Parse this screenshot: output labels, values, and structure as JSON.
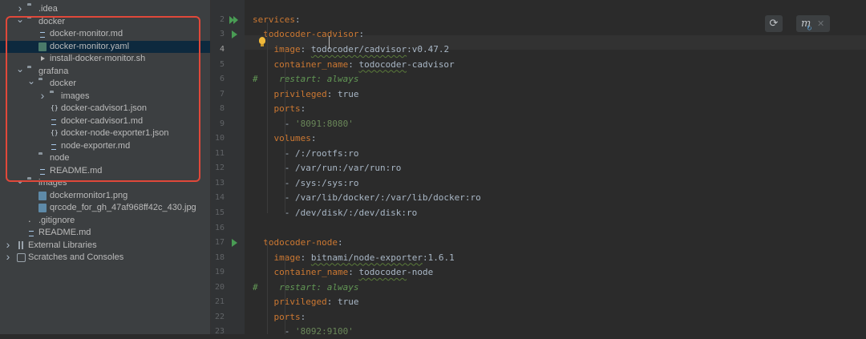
{
  "project_tree": [
    {
      "label": ".idea",
      "depth": 0,
      "kind": "folder",
      "arrow": "right",
      "icon": "folder-icon"
    },
    {
      "label": "docker",
      "depth": 0,
      "kind": "folder",
      "arrow": "down",
      "icon": "folder-icon"
    },
    {
      "label": "docker-monitor.md",
      "depth": 1,
      "kind": "file",
      "icon": "markdown-file-icon"
    },
    {
      "label": "docker-monitor.yaml",
      "depth": 1,
      "kind": "file",
      "icon": "yaml-file-icon",
      "selected": true
    },
    {
      "label": "install-docker-monitor.sh",
      "depth": 1,
      "kind": "file",
      "icon": "shell-script-icon"
    },
    {
      "label": "grafana",
      "depth": 0,
      "kind": "folder",
      "arrow": "down",
      "icon": "folder-icon"
    },
    {
      "label": "docker",
      "depth": 1,
      "kind": "folder",
      "arrow": "down",
      "icon": "folder-icon"
    },
    {
      "label": "images",
      "depth": 2,
      "kind": "folder",
      "arrow": "right",
      "icon": "folder-icon"
    },
    {
      "label": "docker-cadvisor1.json",
      "depth": 2,
      "kind": "file",
      "icon": "json-file-icon"
    },
    {
      "label": "docker-cadvisor1.md",
      "depth": 2,
      "kind": "file",
      "icon": "markdown-file-icon"
    },
    {
      "label": "docker-node-exporter1.json",
      "depth": 2,
      "kind": "file",
      "icon": "json-file-icon"
    },
    {
      "label": "node-exporter.md",
      "depth": 2,
      "kind": "file",
      "icon": "markdown-file-icon"
    },
    {
      "label": "node",
      "depth": 1,
      "kind": "folder",
      "icon": "folder-icon"
    },
    {
      "label": "README.md",
      "depth": 1,
      "kind": "file",
      "icon": "markdown-file-icon"
    },
    {
      "label": "images",
      "depth": 0,
      "kind": "folder",
      "arrow": "down",
      "icon": "folder-icon"
    },
    {
      "label": "dockermonitor1.png",
      "depth": 1,
      "kind": "file",
      "icon": "image-file-icon"
    },
    {
      "label": "qrcode_for_gh_47af968ff42c_430.jpg",
      "depth": 1,
      "kind": "file",
      "icon": "image-file-icon"
    },
    {
      "label": ".gitignore",
      "depth": 0,
      "kind": "file",
      "icon": "gitignore-file-icon"
    },
    {
      "label": "README.md",
      "depth": 0,
      "kind": "file",
      "icon": "markdown-file-icon"
    },
    {
      "label": "External Libraries",
      "depth": -1,
      "kind": "special",
      "arrow": "right",
      "icon": "libraries-icon"
    },
    {
      "label": "Scratches and Consoles",
      "depth": -1,
      "kind": "special",
      "arrow": "right",
      "icon": "scratches-icon"
    }
  ],
  "editor": {
    "current_line": 4,
    "top_partial": [
      {
        "t": "version: ",
        "c": "k"
      }
    ],
    "lines": [
      {
        "n": 2,
        "gutter": "double-run",
        "tokens": [
          {
            "t": "services",
            "c": "k"
          },
          {
            "t": ":",
            "c": "w"
          }
        ]
      },
      {
        "n": 3,
        "gutter": "run",
        "tokens": [
          {
            "t": "  "
          },
          {
            "t": "todocoder-cadvisor",
            "c": "k"
          },
          {
            "t": ":",
            "c": "w"
          }
        ]
      },
      {
        "n": 4,
        "tokens": [
          {
            "t": "    "
          },
          {
            "t": "image",
            "c": "k"
          },
          {
            "t": ": ",
            "c": "w"
          },
          {
            "t": "todocoder/cadvisor",
            "c": "v"
          },
          {
            "t": ":v0.47.2",
            "c": "w"
          }
        ]
      },
      {
        "n": 5,
        "tokens": [
          {
            "t": "    "
          },
          {
            "t": "container_name",
            "c": "k"
          },
          {
            "t": ": ",
            "c": "w"
          },
          {
            "t": "todocoder",
            "c": "v"
          },
          {
            "t": "-cadvisor",
            "c": "w"
          }
        ]
      },
      {
        "n": 6,
        "tokens": [
          {
            "t": "#    restart: always",
            "c": "cm"
          }
        ]
      },
      {
        "n": 7,
        "tokens": [
          {
            "t": "    "
          },
          {
            "t": "privileged",
            "c": "k"
          },
          {
            "t": ": true",
            "c": "w"
          }
        ]
      },
      {
        "n": 8,
        "tokens": [
          {
            "t": "    "
          },
          {
            "t": "ports",
            "c": "k"
          },
          {
            "t": ":",
            "c": "w"
          }
        ]
      },
      {
        "n": 9,
        "tokens": [
          {
            "t": "      - ",
            "c": "w"
          },
          {
            "t": "'8091:8080'",
            "c": "s"
          }
        ]
      },
      {
        "n": 10,
        "tokens": [
          {
            "t": "    "
          },
          {
            "t": "volumes",
            "c": "k"
          },
          {
            "t": ":",
            "c": "w"
          }
        ]
      },
      {
        "n": 11,
        "tokens": [
          {
            "t": "      - /:/rootfs:ro",
            "c": "w"
          }
        ]
      },
      {
        "n": 12,
        "tokens": [
          {
            "t": "      - /var/run:/var/run:ro",
            "c": "w"
          }
        ]
      },
      {
        "n": 13,
        "tokens": [
          {
            "t": "      - /sys:/sys:ro",
            "c": "w"
          }
        ]
      },
      {
        "n": 14,
        "tokens": [
          {
            "t": "      - /var/lib/docker/:/var/lib/docker:ro",
            "c": "w"
          }
        ]
      },
      {
        "n": 15,
        "tokens": [
          {
            "t": "      - /dev/disk/:/dev/disk:ro",
            "c": "w"
          }
        ]
      },
      {
        "n": 16,
        "tokens": []
      },
      {
        "n": 17,
        "gutter": "run",
        "tokens": [
          {
            "t": "  "
          },
          {
            "t": "todocoder-node",
            "c": "k"
          },
          {
            "t": ":",
            "c": "w"
          }
        ]
      },
      {
        "n": 18,
        "tokens": [
          {
            "t": "    "
          },
          {
            "t": "image",
            "c": "k"
          },
          {
            "t": ": ",
            "c": "w"
          },
          {
            "t": "bitnami/node-exporter",
            "c": "v"
          },
          {
            "t": ":1.6.1",
            "c": "w"
          }
        ]
      },
      {
        "n": 19,
        "tokens": [
          {
            "t": "    "
          },
          {
            "t": "container_name",
            "c": "k"
          },
          {
            "t": ": ",
            "c": "w"
          },
          {
            "t": "todocoder",
            "c": "v"
          },
          {
            "t": "-node",
            "c": "w"
          }
        ]
      },
      {
        "n": 20,
        "tokens": [
          {
            "t": "#    restart: always",
            "c": "cm"
          }
        ]
      },
      {
        "n": 21,
        "tokens": [
          {
            "t": "    "
          },
          {
            "t": "privileged",
            "c": "k"
          },
          {
            "t": ": true",
            "c": "w"
          }
        ]
      },
      {
        "n": 22,
        "tokens": [
          {
            "t": "    "
          },
          {
            "t": "ports",
            "c": "k"
          },
          {
            "t": ":",
            "c": "w"
          }
        ]
      },
      {
        "n": 23,
        "tokens": [
          {
            "t": "      - ",
            "c": "w"
          },
          {
            "t": "'8092:9100'",
            "c": "s"
          }
        ]
      }
    ]
  },
  "toolbar": {
    "reload_icon": "reload-icon",
    "maven_label": "m"
  },
  "colors": {
    "highlight_box": "#e0483a",
    "selection": "#0d293e",
    "keyword": "#cc7832",
    "string": "#6a8759",
    "comment": "#629755"
  }
}
